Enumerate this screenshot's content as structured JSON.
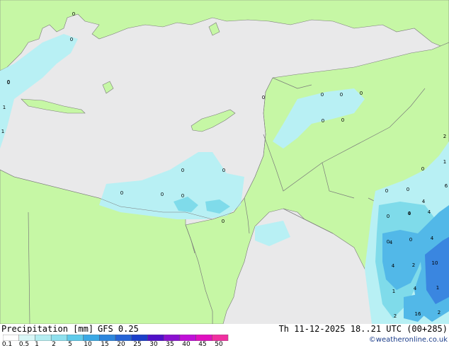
{
  "map": {
    "colors": {
      "sea": "#e9e9ea",
      "land": "#c6f7a5",
      "border": "#7a7a7a",
      "precip_light": "#b8f0f4",
      "precip_mid": "#7fdbea",
      "precip_strong": "#52b8e8",
      "precip_heavy": "#3a86e0"
    },
    "labels": [
      "0",
      "0",
      "0",
      "1",
      "0",
      "0",
      "0",
      "0",
      "0",
      "0",
      "0",
      "0",
      "0",
      "0",
      "0",
      "0",
      "0",
      "0",
      "0",
      "0",
      "0",
      "4",
      "4",
      "2",
      "1",
      "4",
      "0",
      "4",
      "4",
      "4",
      "2",
      "10",
      "1",
      "4",
      "1",
      "16",
      "2",
      "2",
      "1",
      "0",
      "0",
      "6"
    ]
  },
  "footer": {
    "title": "Precipitation [mm]",
    "model": "GFS 0.25",
    "valid": "Th 11-12-2025 18..21 UTC (00+285)",
    "credit": "©weatheronline.co.uk"
  },
  "legend": {
    "ticks": [
      "0.1",
      "0.5",
      "1",
      "2",
      "5",
      "10",
      "15",
      "20",
      "25",
      "30",
      "35",
      "40",
      "45",
      "50"
    ],
    "colors": [
      "#ffffff",
      "#d9f7f7",
      "#b4eef2",
      "#8ee0ee",
      "#5fcbea",
      "#3aa8e4",
      "#2d86dd",
      "#2563d6",
      "#1b3ec9",
      "#5010c8",
      "#8a10d0",
      "#c010d8",
      "#e010c0",
      "#f030a0"
    ]
  }
}
